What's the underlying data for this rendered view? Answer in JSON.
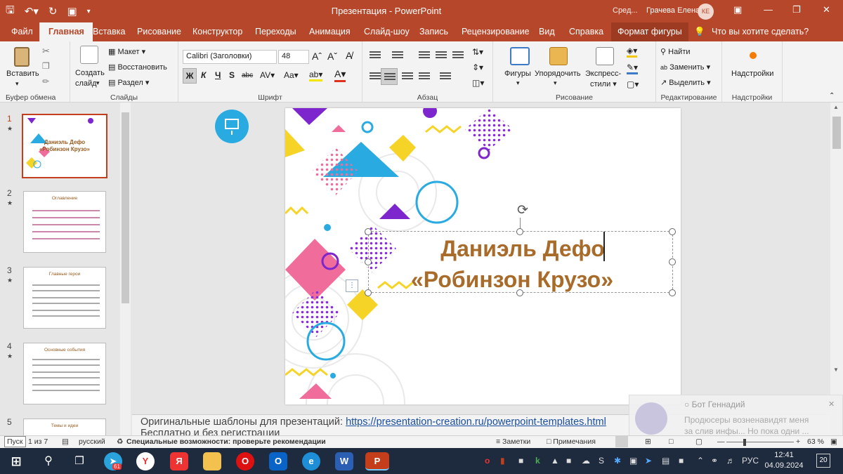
{
  "title_bar": {
    "doc_title": "Презентация - PowerPoint",
    "search_short": "Сред...",
    "user_name": "Грачева Елена",
    "user_initials": "КЕ"
  },
  "tabs": [
    "Файл",
    "Главная",
    "Вставка",
    "Рисование",
    "Конструктор",
    "Переходы",
    "Анимация",
    "Слайд-шоу",
    "Запись",
    "Рецензирование",
    "Вид",
    "Справка",
    "Формат фигуры"
  ],
  "tell_me": "Что вы хотите сделать?",
  "ribbon": {
    "clipboard": {
      "paste": "Вставить",
      "label": "Буфер обмена"
    },
    "slides": {
      "new_slide_1": "Создать",
      "new_slide_2": "слайд",
      "layout": "Макет",
      "reset": "Восстановить",
      "section": "Раздел",
      "label": "Слайды"
    },
    "font": {
      "font_name": "Calibri (Заголовки)",
      "font_size": "48",
      "bold": "Ж",
      "italic": "К",
      "underline": "Ч",
      "strike": "S",
      "label": "Шрифт"
    },
    "paragraph": {
      "label": "Абзац"
    },
    "drawing": {
      "shapes": "Фигуры",
      "arrange": "Упорядочить",
      "styles_1": "Экспресс-",
      "styles_2": "стили",
      "label": "Рисование"
    },
    "editing": {
      "find": "Найти",
      "replace": "Заменить",
      "select": "Выделить",
      "label": "Редактирование"
    },
    "addins": {
      "addins": "Надстройки",
      "label": "Надстройки"
    }
  },
  "thumbnails": [
    {
      "num": "1",
      "title_1": "Даниэль Дефо",
      "title_2": "«Робинзон Крузо»"
    },
    {
      "num": "2",
      "title": "Оглавление"
    },
    {
      "num": "3",
      "title": "Главные герои"
    },
    {
      "num": "4",
      "title": "Основные события"
    },
    {
      "num": "5",
      "title": "Темы и идеи"
    }
  ],
  "slide": {
    "title_line1": "Даниэль Дефо",
    "title_line2": "«Робинзон Крузо»",
    "accent_title_color": "#a86b2a"
  },
  "notes": {
    "prefix": "Оригинальные шаблоны для презентаций: ",
    "link": "https://presentation-creation.ru/powerpoint-templates.html",
    "line2": "Бесплатно и без регистрации"
  },
  "toast": {
    "bot": "Бот Геннадий",
    "line1": "Продюсеры возненавидят меня",
    "line2": "за слив инфы... Но пока одни ..."
  },
  "status": {
    "start": "Пуск",
    "slide_of": "1 из 7",
    "lang": "русский",
    "accessibility": "Специальные возможности: проверьте рекомендации",
    "notes_btn": "Заметки",
    "comments_btn": "Примечания",
    "zoom": "63 %"
  },
  "taskbar": {
    "tg_badge": "61",
    "lang": "РУС",
    "time": "12:41",
    "date": "04.09.2024",
    "notif": "20"
  }
}
